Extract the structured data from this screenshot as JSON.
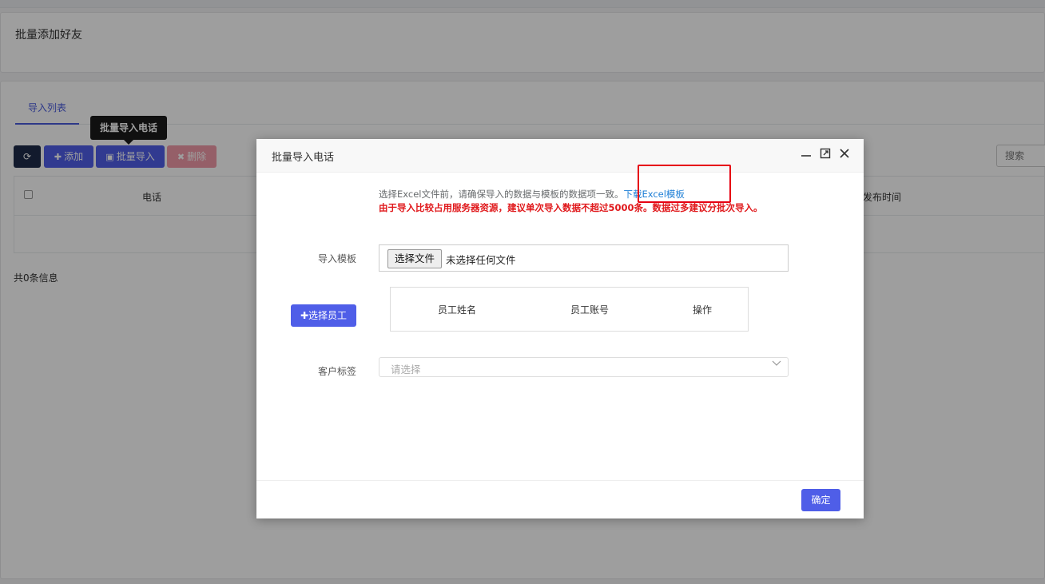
{
  "page": {
    "card_title": "批量添加好友",
    "tab_label": "导入列表",
    "toolbar": {
      "add_label": "添加",
      "import_label": "批量导入",
      "delete_label": "删除"
    },
    "tooltip": "批量导入电话",
    "search_placeholder": "搜索",
    "table": {
      "col_phone": "电话",
      "col_time": "发布时间"
    },
    "count_text": "共0条信息"
  },
  "modal": {
    "title": "批量导入电话",
    "hint_text": "选择Excel文件前，请确保导入的数据与模板的数据项一致。",
    "download_link": "下载Excel模板",
    "warning_text": "由于导入比较占用服务器资源，建议单次导入数据不超过5000条。数据过多建议分批次导入。",
    "template_label": "导入模板",
    "file_button": "选择文件",
    "file_none": "未选择任何文件",
    "select_employee_button": "选择员工",
    "employee_table": {
      "col_name": "员工姓名",
      "col_account": "员工账号",
      "col_op": "操作"
    },
    "tag_label": "客户标签",
    "tag_placeholder": "请选择",
    "ok_button": "确定"
  },
  "colors": {
    "primary": "#4f5ee8",
    "danger_text": "#e0181b",
    "link": "#1e7fd6",
    "highlight_box": "#e60012"
  }
}
